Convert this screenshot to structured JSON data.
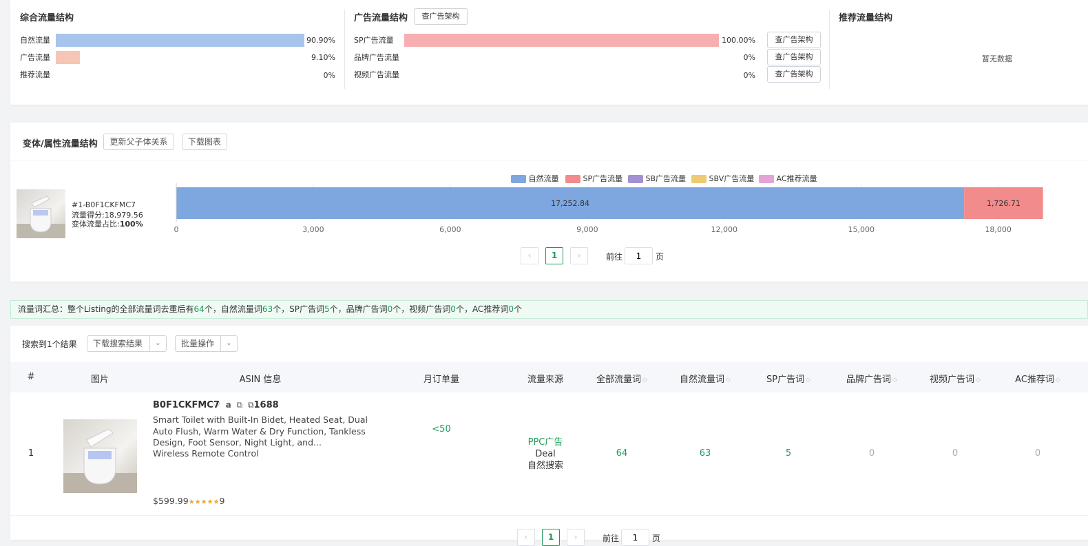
{
  "overall": {
    "title": "综合流量结构",
    "rows": [
      {
        "label": "自然流量",
        "value": "90.90%",
        "ratio": 0.909,
        "color": "#a6c4ec"
      },
      {
        "label": "广告流量",
        "value": "9.10%",
        "ratio": 0.091,
        "color": "#f5c6b6"
      },
      {
        "label": "推荐流量",
        "value": "0%",
        "ratio": 0,
        "color": "#ddd"
      }
    ]
  },
  "ads": {
    "title": "广告流量结构",
    "view_button": "查广告架构",
    "rows": [
      {
        "label": "SP广告流量",
        "value": "100.00%",
        "ratio": 1.0,
        "color": "#f7aeb0",
        "button": "查广告架构"
      },
      {
        "label": "品牌广告流量",
        "value": "0%",
        "ratio": 0,
        "color": "#ddd",
        "button": "查广告架构"
      },
      {
        "label": "视频广告流量",
        "value": "0%",
        "ratio": 0,
        "color": "#ddd",
        "button": "查广告架构"
      }
    ]
  },
  "recommend": {
    "title": "推荐流量结构",
    "empty": "暂无数据"
  },
  "variant": {
    "title": "变体/属性流量结构",
    "update_button": "更新父子体关系",
    "download_button": "下载图表",
    "item": {
      "name": "#1-B0F1CKFMC7",
      "score": "流量得分:18,979.56",
      "share_prefix": "变体流量占比:",
      "share": "100%"
    },
    "pager": {
      "current": "1",
      "goto_label": "前往",
      "goto_value": "1",
      "page_unit": "页"
    }
  },
  "chart_data": {
    "type": "bar",
    "orientation": "horizontal",
    "stacked": true,
    "categories": [
      "#1-B0F1CKFMC7"
    ],
    "series": [
      {
        "name": "自然流量",
        "values": [
          17252.84
        ],
        "color": "#7ea7e0",
        "label": "17,252.84"
      },
      {
        "name": "SP广告流量",
        "values": [
          1726.71
        ],
        "color": "#f28b8b",
        "label": "1,726.71"
      },
      {
        "name": "SB广告流量",
        "values": [
          0
        ],
        "color": "#a390d4"
      },
      {
        "name": "SBV广告流量",
        "values": [
          0
        ],
        "color": "#eccb72"
      },
      {
        "name": "AC推荐流量",
        "values": [
          0
        ],
        "color": "#e3a3d8"
      }
    ],
    "x_ticks": [
      "0",
      "3,000",
      "6,000",
      "9,000",
      "12,000",
      "15,000",
      "18,000"
    ],
    "xlim": [
      0,
      19000
    ],
    "legend": "top-center",
    "grid": true
  },
  "summary": {
    "prefix": "流量词汇总：整个Listing的全部流量词去重后有",
    "total": "64",
    "t1": "个，自然流量词",
    "natural": "63",
    "t2": "个，SP广告词",
    "sp": "5",
    "t3": "个，品牌广告词",
    "brand": "0",
    "t4": "个，视频广告词",
    "video": "0",
    "t5": "个，AC推荐词",
    "ac": "0",
    "t6": "个"
  },
  "results": {
    "count_text": "搜索到1个结果",
    "download_button": "下载搜索结果",
    "batch_button": "批量操作",
    "columns": [
      "#",
      "图片",
      "ASIN 信息",
      "月订单量",
      "流量来源",
      "全部流量词",
      "自然流量词",
      "SP广告词",
      "品牌广告词",
      "视频广告词",
      "AC推荐词"
    ],
    "rows": [
      {
        "index": "1",
        "asin": "B0F1CKFMC7",
        "link_1688": "1688",
        "title": "Smart Toilet with Built-In Bidet, Heated Seat, Dual Auto Flush, Warm Water & Dry Function, Tankless Design, Foot Sensor, Night Light, and...",
        "subtitle": "Wireless Remote Control",
        "price": "$599.99",
        "stars": "★★★★★",
        "reviews": "9",
        "monthly_orders": "<50",
        "source_ppc": "PPC广告",
        "source_deal": "Deal",
        "source_organic": "自然搜索",
        "all_words": "64",
        "natural_words": "63",
        "sp_words": "5",
        "brand_words": "0",
        "video_words": "0",
        "ac_words": "0"
      }
    ],
    "pager": {
      "current": "1",
      "goto_label": "前往",
      "goto_value": "1",
      "page_unit": "页"
    }
  }
}
